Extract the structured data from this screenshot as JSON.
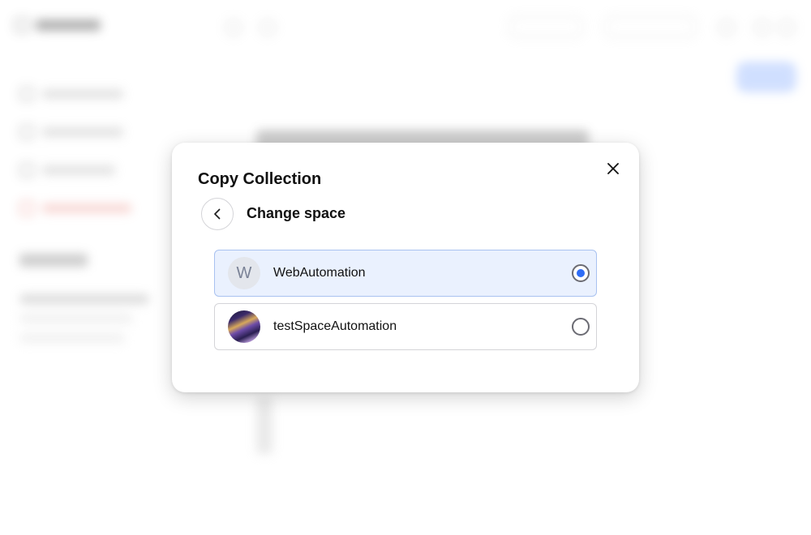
{
  "modal": {
    "title": "Copy Collection",
    "subtitle": "Change space",
    "options": [
      {
        "label": "WebAutomation",
        "avatar_letter": "W",
        "selected": true
      },
      {
        "label": "testSpaceAutomation",
        "avatar_letter": "",
        "selected": false
      }
    ]
  },
  "colors": {
    "accent": "#2f6df6",
    "selected_bg": "#eaf1fe"
  },
  "icons": {
    "close": "close-icon",
    "back": "chevron-left-icon"
  }
}
